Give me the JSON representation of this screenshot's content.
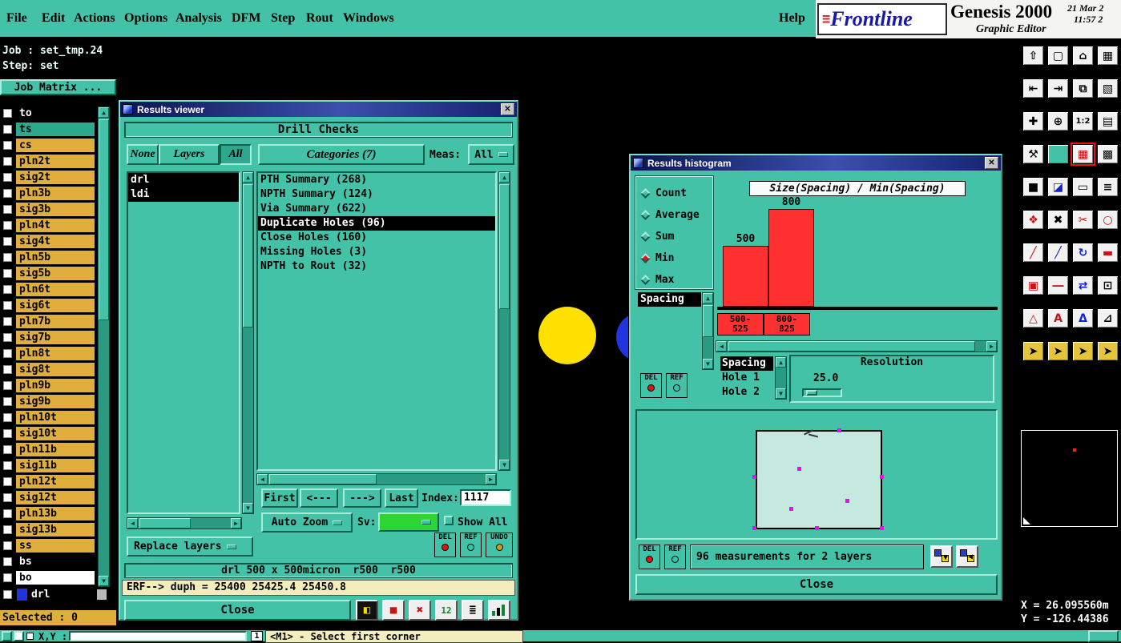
{
  "menu": {
    "items": [
      "File",
      "Edit",
      "Actions",
      "Options",
      "Analysis",
      "DFM",
      "Step",
      "Rout",
      "Windows"
    ],
    "help": "Help"
  },
  "brand": {
    "frontline": "Frontline",
    "arrows": "≡",
    "product": "Genesis 2000",
    "date": "21 Mar 2",
    "time": "11:57 2",
    "subtitle": "Graphic Editor"
  },
  "left_panel": {
    "job_label": "Job : set_tmp.24",
    "step_label": "Step: set",
    "matrix_button": "Job Matrix ...",
    "selected_label": "Selected : 0"
  },
  "layers": [
    {
      "name": "to"
    },
    {
      "name": "ts"
    },
    {
      "name": "cs"
    },
    {
      "name": "pln2t"
    },
    {
      "name": "sig2t"
    },
    {
      "name": "pln3b"
    },
    {
      "name": "sig3b"
    },
    {
      "name": "pln4t"
    },
    {
      "name": "sig4t"
    },
    {
      "name": "pln5b"
    },
    {
      "name": "sig5b"
    },
    {
      "name": "pln6t"
    },
    {
      "name": "sig6t"
    },
    {
      "name": "pln7b"
    },
    {
      "name": "sig7b"
    },
    {
      "name": "pln8t"
    },
    {
      "name": "sig8t"
    },
    {
      "name": "pln9b"
    },
    {
      "name": "sig9b"
    },
    {
      "name": "pln10t"
    },
    {
      "name": "sig10t"
    },
    {
      "name": "pln11b"
    },
    {
      "name": "sig11b"
    },
    {
      "name": "pln12t"
    },
    {
      "name": "sig12t"
    },
    {
      "name": "pln13b"
    },
    {
      "name": "sig13b"
    },
    {
      "name": "ss"
    },
    {
      "name": "bs"
    },
    {
      "name": "bo"
    },
    {
      "name": "drl"
    }
  ],
  "viewer": {
    "title": "Results viewer",
    "header": "Drill Checks",
    "none_btn": "None",
    "layers_btn": "Layers",
    "all_btn": "All",
    "categories_header": "Categories (7)",
    "meas_label": "Meas:",
    "meas_value": "All",
    "layer_items": [
      "drl",
      "ldi"
    ],
    "categories": [
      "PTH Summary (268)",
      "NPTH Summary (124)",
      "Via Summary (622)",
      "Duplicate Holes (96)",
      "Close Holes (160)",
      "Missing Holes (3)",
      "NPTH to Rout (32)"
    ],
    "first": "First",
    "prev": "<---",
    "next": "--->",
    "last": "Last",
    "index_label": "Index:",
    "index_value": "1117",
    "auto_zoom": "Auto Zoom",
    "sv_label": "Sv:",
    "show_all": "Show All",
    "replace_layers": "Replace layers",
    "del": "DEL",
    "ref": "REF",
    "undo": "UNDO",
    "info_line": "drl 500 x 500micron  r500  r500",
    "erf_line": "ERF--> duph = 25400 25425.4 25450.8",
    "close": "Close",
    "sv_color": "#2fd435"
  },
  "histogram": {
    "title": "Results histogram",
    "stats": [
      "Count",
      "Average",
      "Sum",
      "Min",
      "Max"
    ],
    "selected_stat": "Min",
    "measure": "Spacing",
    "chart_title": "Size(Spacing) / Min(Spacing)",
    "bins": [
      [
        "500-",
        "525"
      ],
      [
        "800-",
        "825"
      ]
    ],
    "params": [
      "Spacing",
      "Hole 1",
      "Hole 2"
    ],
    "resolution_label": "Resolution",
    "resolution_value": "25.0",
    "del": "DEL",
    "ref": "REF",
    "summary": "96 measurements for 2 layers",
    "close": "Close"
  },
  "chart_data": {
    "type": "bar",
    "title": "Size(Spacing) / Min(Spacing)",
    "categories": [
      "500-525",
      "800-825"
    ],
    "values": [
      500,
      800
    ],
    "series_label": "Min(Spacing)",
    "bar_color": "#ff3030",
    "ylim": [
      0,
      900
    ],
    "grid": false,
    "legend": false
  },
  "toolbar": {
    "icons": [
      "⇧",
      "▢",
      "⌂",
      "▦",
      "⇤",
      "⇥",
      "⧉",
      "▧",
      "✚",
      "⊕",
      "1:2",
      "▤",
      "⚒",
      "",
      "▦",
      "▩",
      "■",
      "◪",
      "▭",
      "≡",
      "❖",
      "✖",
      "✂",
      "○",
      "╱",
      "╱",
      "↻",
      "▬",
      "▣",
      "―",
      "⇄",
      "⊡",
      "△",
      "A",
      "Δ",
      "⊿",
      "➤",
      "➤",
      "➤",
      "➤"
    ]
  },
  "status": {
    "x": "X = 26.095560m",
    "y": "Y = -126.44386",
    "xy_label": "X,Y :",
    "one": "1",
    "hint": "<M1> - Select first corner"
  },
  "icons": {
    "close": "✕",
    "up": "▲",
    "down": "▼",
    "left": "◀",
    "right": "▶"
  },
  "colors": {
    "teal": "#44c2a8",
    "gold": "#dfae3c",
    "bar_red": "#ff3030",
    "cream": "#f2edbb",
    "magenta": "#ff00ff",
    "yellow_pad": "#ffe000",
    "blue_pad": "#2233e0"
  }
}
